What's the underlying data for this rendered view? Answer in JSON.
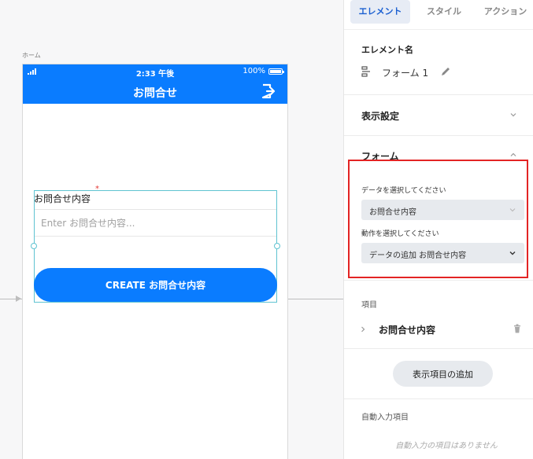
{
  "canvas": {
    "screen_label": "ホーム",
    "status_bar": {
      "time": "2:33 午後",
      "battery": "100%"
    },
    "header": {
      "title": "お問合せ"
    },
    "form": {
      "field_label": "お問合せ内容",
      "field_placeholder": "Enter お問合せ内容...",
      "required_mark": "*",
      "submit_label": "CREATE お問合せ内容"
    }
  },
  "panel": {
    "tabs": [
      {
        "label": "エレメント",
        "active": true
      },
      {
        "label": "スタイル",
        "active": false
      },
      {
        "label": "アクション",
        "active": false
      }
    ],
    "element_name": {
      "heading": "エレメント名",
      "value": "フォーム 1"
    },
    "display_settings": {
      "title": "表示設定"
    },
    "form_section": {
      "title": "フォーム",
      "data_select": {
        "label": "データを選択してください",
        "value": "お問合せ内容"
      },
      "action_select": {
        "label": "動作を選択してください",
        "value": "データの追加 お問合せ内容"
      }
    },
    "items": {
      "label": "項目",
      "list": [
        {
          "label": "お問合せ内容"
        }
      ],
      "add_button": "表示項目の追加"
    },
    "auto_input": {
      "label": "自動入力項目",
      "empty_text": "自動入力の項目はありません"
    }
  },
  "colors": {
    "brand_blue": "#0a7cff",
    "highlight_red": "#e32424",
    "selection_teal": "#5fc3d1"
  },
  "icons": [
    "signal-icon",
    "battery-icon",
    "logout-icon",
    "form-icon",
    "pencil-icon",
    "chevron-down-icon",
    "chevron-up-icon",
    "chevron-right-icon",
    "trash-icon"
  ]
}
